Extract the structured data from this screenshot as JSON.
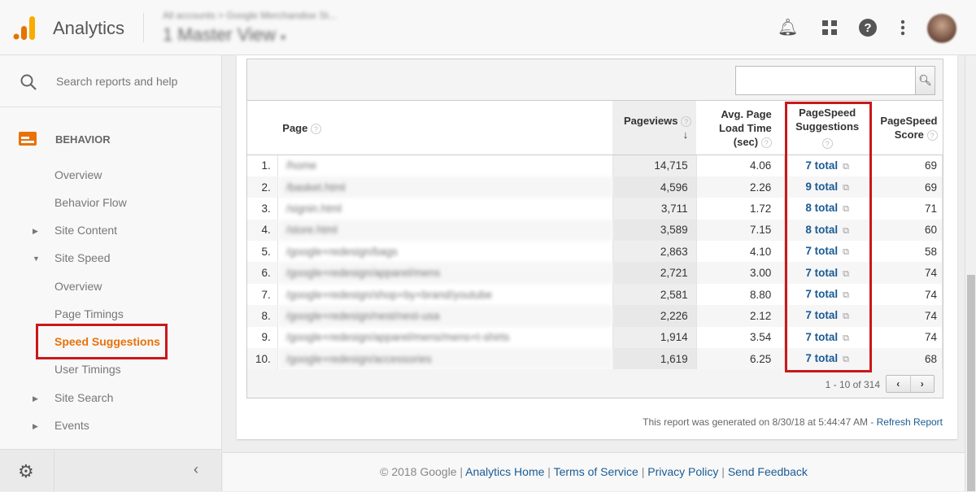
{
  "header": {
    "app_name": "Analytics",
    "account_path": "All accounts > Google Merchandise St...",
    "view_name": "1 Master View",
    "view_caret": "▾"
  },
  "sidebar": {
    "search_placeholder": "Search reports and help",
    "section": "BEHAVIOR",
    "items": [
      {
        "label": "Overview"
      },
      {
        "label": "Behavior Flow"
      },
      {
        "label": "Site Content",
        "arrow": "▶"
      },
      {
        "label": "Site Speed",
        "arrow": "▼"
      },
      {
        "label": "Overview"
      },
      {
        "label": "Page Timings"
      },
      {
        "label": "Speed Suggestions",
        "active": true
      },
      {
        "label": "User Timings"
      },
      {
        "label": "Site Search",
        "arrow": "▶"
      },
      {
        "label": "Events",
        "arrow": "▶"
      }
    ]
  },
  "table": {
    "columns": {
      "page": "Page",
      "pageviews": "Pageviews",
      "sort": "↓",
      "load_time_1": "Avg. Page",
      "load_time_2": "Load Time",
      "load_time_3": "(sec)",
      "sugg_1": "PageSpeed",
      "sugg_2": "Suggestions",
      "score_1": "PageSpeed",
      "score_2": "Score",
      "help": "?"
    },
    "rows": [
      {
        "idx": "1.",
        "page": "/home",
        "pageviews": "14,715",
        "load": "4.06",
        "sugg": "7 total",
        "score": "69"
      },
      {
        "idx": "2.",
        "page": "/basket.html",
        "pageviews": "4,596",
        "load": "2.26",
        "sugg": "9 total",
        "score": "69"
      },
      {
        "idx": "3.",
        "page": "/signin.html",
        "pageviews": "3,711",
        "load": "1.72",
        "sugg": "8 total",
        "score": "71"
      },
      {
        "idx": "4.",
        "page": "/store.html",
        "pageviews": "3,589",
        "load": "7.15",
        "sugg": "8 total",
        "score": "60"
      },
      {
        "idx": "5.",
        "page": "/google+redesign/bags",
        "pageviews": "2,863",
        "load": "4.10",
        "sugg": "7 total",
        "score": "58"
      },
      {
        "idx": "6.",
        "page": "/google+redesign/apparel/mens",
        "pageviews": "2,721",
        "load": "3.00",
        "sugg": "7 total",
        "score": "74"
      },
      {
        "idx": "7.",
        "page": "/google+redesign/shop+by+brand/youtube",
        "pageviews": "2,581",
        "load": "8.80",
        "sugg": "7 total",
        "score": "74"
      },
      {
        "idx": "8.",
        "page": "/google+redesign/nest/nest-usa",
        "pageviews": "2,226",
        "load": "2.12",
        "sugg": "7 total",
        "score": "74"
      },
      {
        "idx": "9.",
        "page": "/google+redesign/apparel/mens/mens+t-shirts",
        "pageviews": "1,914",
        "load": "3.54",
        "sugg": "7 total",
        "score": "74"
      },
      {
        "idx": "10.",
        "page": "/google+redesign/accessories",
        "pageviews": "1,619",
        "load": "6.25",
        "sugg": "7 total",
        "score": "68"
      }
    ],
    "pagination": "1 - 10 of 314",
    "prev": "‹",
    "next": "›"
  },
  "report": {
    "generated": "This report was generated on 8/30/18 at 5:44:47 AM - ",
    "refresh": "Refresh Report"
  },
  "footer": {
    "copyright": "© 2018 Google | ",
    "links": [
      "Analytics Home",
      "Terms of Service",
      "Privacy Policy",
      "Send Feedback"
    ],
    "sep": " | "
  },
  "colors": {
    "accent": "#e8710a",
    "highlight": "#c8191b",
    "link": "#1a5b94"
  }
}
